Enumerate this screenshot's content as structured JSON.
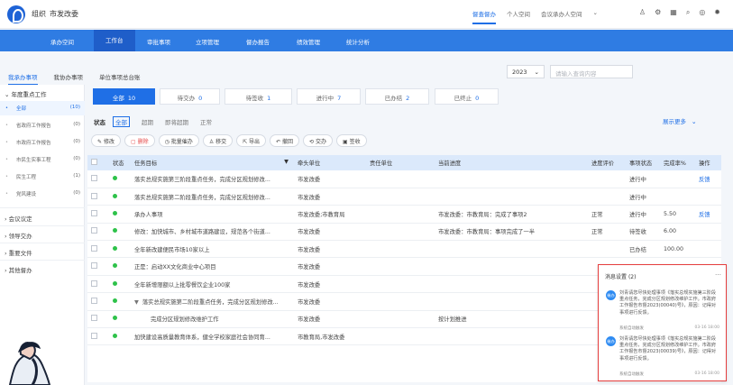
{
  "header": {
    "org": "组织",
    "department": "市发改委",
    "links": [
      "督查督办",
      "个人空间",
      "会议承办人空间"
    ],
    "active_link": "督查督办",
    "icons": [
      "user-icon",
      "settings-icon",
      "grid-icon",
      "search-icon",
      "message-icon",
      "gear-icon"
    ]
  },
  "nav": {
    "items": [
      "承办空间",
      "工作台",
      "审批事项",
      "立项管理",
      "督办报告",
      "绩效管理",
      "统计分析"
    ],
    "active": "工作台"
  },
  "sub_tabs": {
    "items": [
      "我承办事项",
      "我协办事项",
      "单位事项总台账"
    ],
    "active": "我承办事项"
  },
  "search": {
    "year": "2023",
    "placeholder": "请输入查询内容"
  },
  "sidebar": {
    "section": "年度重点工作",
    "items": [
      {
        "label": "全部",
        "count": "(10)"
      },
      {
        "label": "省政府工作报告",
        "count": "(0)"
      },
      {
        "label": "市政府工作报告",
        "count": "(0)"
      },
      {
        "label": "市民生实事工程",
        "count": "(0)"
      },
      {
        "label": "民生工程",
        "count": "(1)"
      },
      {
        "label": "党风建设",
        "count": "(0)"
      }
    ],
    "groups": [
      "会议议定",
      "领导交办",
      "重要文件",
      "其他督办"
    ]
  },
  "status_cards": [
    {
      "label": "全部",
      "count": "10"
    },
    {
      "label": "待交办",
      "count": "0"
    },
    {
      "label": "待签收",
      "count": "1"
    },
    {
      "label": "进行中",
      "count": "7"
    },
    {
      "label": "已办结",
      "count": "2"
    },
    {
      "label": "已终止",
      "count": "0"
    }
  ],
  "filters": {
    "title": "状态",
    "options": [
      "全部",
      "超期",
      "即将超期",
      "正常"
    ],
    "active": "全部",
    "more": "展示更多"
  },
  "toolbar": [
    "修改",
    "删除",
    "批量催办",
    "移交",
    "导出",
    "撤回",
    "交办",
    "签收"
  ],
  "table": {
    "columns": [
      "",
      "状态",
      "任务目标",
      "牵头单位",
      "责任单位",
      "当前进度",
      "进度评价",
      "事项状态",
      "完成率%",
      "操作"
    ],
    "rows": [
      {
        "task": "落实总规实施第三阶段重点任务，完成分区规划修改...",
        "lead": "市发改委",
        "resp": "",
        "progress": "",
        "eval": "",
        "state": "进行中",
        "rate": "",
        "action": "反馈"
      },
      {
        "task": "落实总规实施第二阶段重点任务，完成分区规划修改...",
        "lead": "市发改委",
        "resp": "",
        "progress": "",
        "eval": "",
        "state": "进行中",
        "rate": "",
        "action": ""
      },
      {
        "task": "承办人事项",
        "lead": "市发改委;市教育局",
        "resp": "",
        "progress": "市发改委：市教育局：完成了事项2",
        "eval": "正常",
        "state": "进行中",
        "rate": "5.50",
        "action": "反馈"
      },
      {
        "task": "修改：加快城市、乡村城市道路建设，规范各个街道...",
        "lead": "市发改委",
        "resp": "",
        "progress": "市发改委：市教育局：事项完成了一半",
        "eval": "正常",
        "state": "待签收",
        "rate": "6.00",
        "action": ""
      },
      {
        "task": "全年新改建便民市场10家以上",
        "lead": "市发改委",
        "resp": "",
        "progress": "",
        "eval": "",
        "state": "已办结",
        "rate": "100.00",
        "action": ""
      },
      {
        "task": "正是：启动XX文化商业中心项目",
        "lead": "市发改委",
        "resp": "",
        "progress": "",
        "eval": "",
        "state": "",
        "rate": "",
        "action": ""
      },
      {
        "task": "全年新增限额以上批零餐饮企业100家",
        "lead": "市发改委",
        "resp": "",
        "progress": "",
        "eval": "",
        "state": "",
        "rate": "",
        "action": ""
      },
      {
        "task": "落实总规实施第二阶段重点任务，完成分区规划修改...",
        "lead": "市发改委",
        "resp": "",
        "progress": "",
        "eval": "",
        "state": "",
        "rate": "",
        "action": ""
      },
      {
        "task": "完成分区规划修改维护工作",
        "lead": "市发改委",
        "resp": "",
        "progress": "按计划推进",
        "eval": "",
        "state": "",
        "rate": "",
        "action": ""
      },
      {
        "task": "加快建设高质量教育体系，健全学校家庭社会协同育...",
        "lead": "市教育局,市发改委",
        "resp": "",
        "progress": "",
        "eval": "",
        "state": "",
        "rate": "",
        "action": ""
      }
    ]
  },
  "notifications": {
    "title": "消息设置",
    "count": "(2)",
    "items": [
      {
        "icon": "催办",
        "text": "刘青请您尽快处理事项《落实总规实施第三阶段重点任务，完成分区规划修改维护工作。市政府工作报告市督2023(00040)号》，原因：记得对事项进行反馈。",
        "source": "系统自动触发",
        "date": "03-16 18:00"
      },
      {
        "icon": "催办",
        "text": "刘青请您尽快处理事项《落实总规实施第二阶段重点任务，完成分区规划修改维护工作。市政府工作报告市督2023(00039)号》，原因：记得对事项进行反馈。",
        "source": "系统自动触发",
        "date": "03-16 18:00"
      }
    ]
  },
  "colors": {
    "primary": "#2f7ce3",
    "accent": "#1f6fe6",
    "status_green": "#2ec24a",
    "alert_border": "#e53e3e"
  }
}
